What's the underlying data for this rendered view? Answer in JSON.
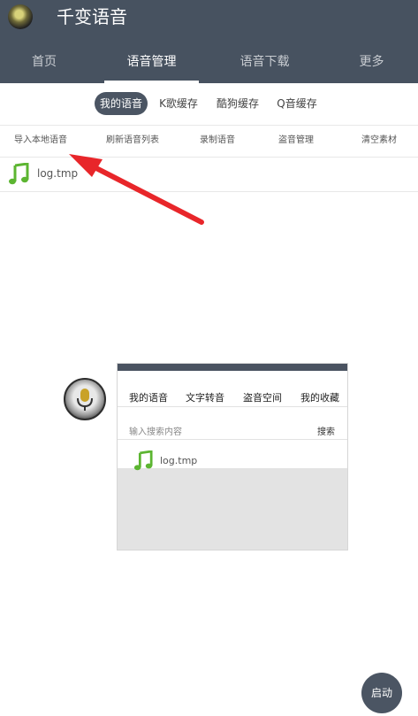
{
  "app": {
    "title": "千变语音",
    "logo_icon": "app-avatar-icon"
  },
  "nav": {
    "tabs": [
      "首页",
      "语音管理",
      "语音下载",
      "更多"
    ],
    "active_index": 1
  },
  "subtabs": {
    "items": [
      "我的语音",
      "K歌缓存",
      "酷狗缓存",
      "Q音缓存"
    ],
    "active_index": 0
  },
  "actions": [
    "导入本地语音",
    "刷新语音列表",
    "录制语音",
    "盗音管理",
    "清空素材"
  ],
  "files": [
    {
      "name": "log.tmp",
      "icon": "music-note-icon"
    }
  ],
  "overlay": {
    "mic_icon": "microphone-icon",
    "tabs": [
      "我的语音",
      "文字转音",
      "盗音空间",
      "我的收藏"
    ],
    "search_placeholder": "输入搜索内容",
    "search_button": "搜索",
    "files": [
      {
        "name": "log.tmp"
      }
    ]
  },
  "start_button": "启动",
  "colors": {
    "header": "#475260",
    "accent_green": "#5cb531",
    "arrow_red": "#e8262a",
    "button_dark": "#4b5563"
  }
}
